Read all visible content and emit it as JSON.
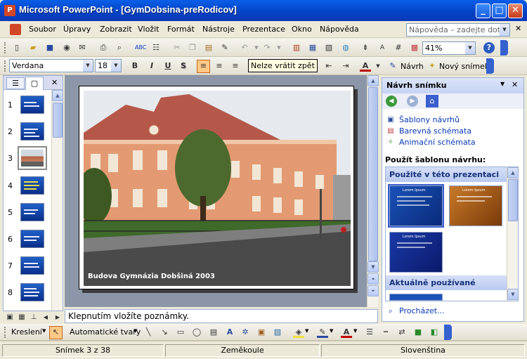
{
  "window": {
    "title": "Microsoft PowerPoint - [GymDobsina-preRodicov]",
    "minimize": "_",
    "maximize": "□",
    "close": "✕"
  },
  "menubar": {
    "items": [
      "Soubor",
      "Úpravy",
      "Zobrazit",
      "Vložit",
      "Formát",
      "Nástroje",
      "Prezentace",
      "Okno",
      "Nápověda"
    ],
    "help_search_placeholder": "Nápověda – zadejte dotaz",
    "close_doc": "✕"
  },
  "toolbar_standard": {
    "zoom": "41%"
  },
  "toolbar_formatting": {
    "font": "Verdana",
    "size": "18",
    "bold": "B",
    "italic": "I",
    "underline": "U",
    "shadow": "S",
    "design_label": "Návrh",
    "new_slide_label": "Nový snímek",
    "font_color": "A"
  },
  "tooltip": {
    "text": "Nelze vrátit zpět"
  },
  "slides_pane": {
    "numbers": [
      "1",
      "2",
      "3",
      "4",
      "5",
      "6",
      "7",
      "8"
    ],
    "selected": 3,
    "close": "✕"
  },
  "slide": {
    "caption": "Budova Gymnázia Dobšiná 2003"
  },
  "notes": {
    "placeholder": "Klepnutím vložíte poznámky."
  },
  "task_pane": {
    "title": "Návrh snímku",
    "links": [
      "Šablony návrhů",
      "Barevná schémata",
      "Animační schémata"
    ],
    "apply_label": "Použít šablonu návrhu:",
    "section_used": "Použité v této prezentaci",
    "section_recent": "Aktuálně používané",
    "browse": "Procházet...",
    "template_title": "Lorem Ipsum",
    "close": "✕"
  },
  "drawing_toolbar": {
    "draw_label": "Kreslení",
    "autoshapes_label": "Automatické tvary"
  },
  "statusbar": {
    "slide_info": "Snímek 3 z 38",
    "design_name": "Zeměkoule",
    "language": "Slovenština"
  },
  "colors": {
    "titlebar": "#0543C6",
    "slide_bg": "#8C96A8",
    "template_blue": "#1A52B8",
    "template_orange": "#B8671A"
  }
}
